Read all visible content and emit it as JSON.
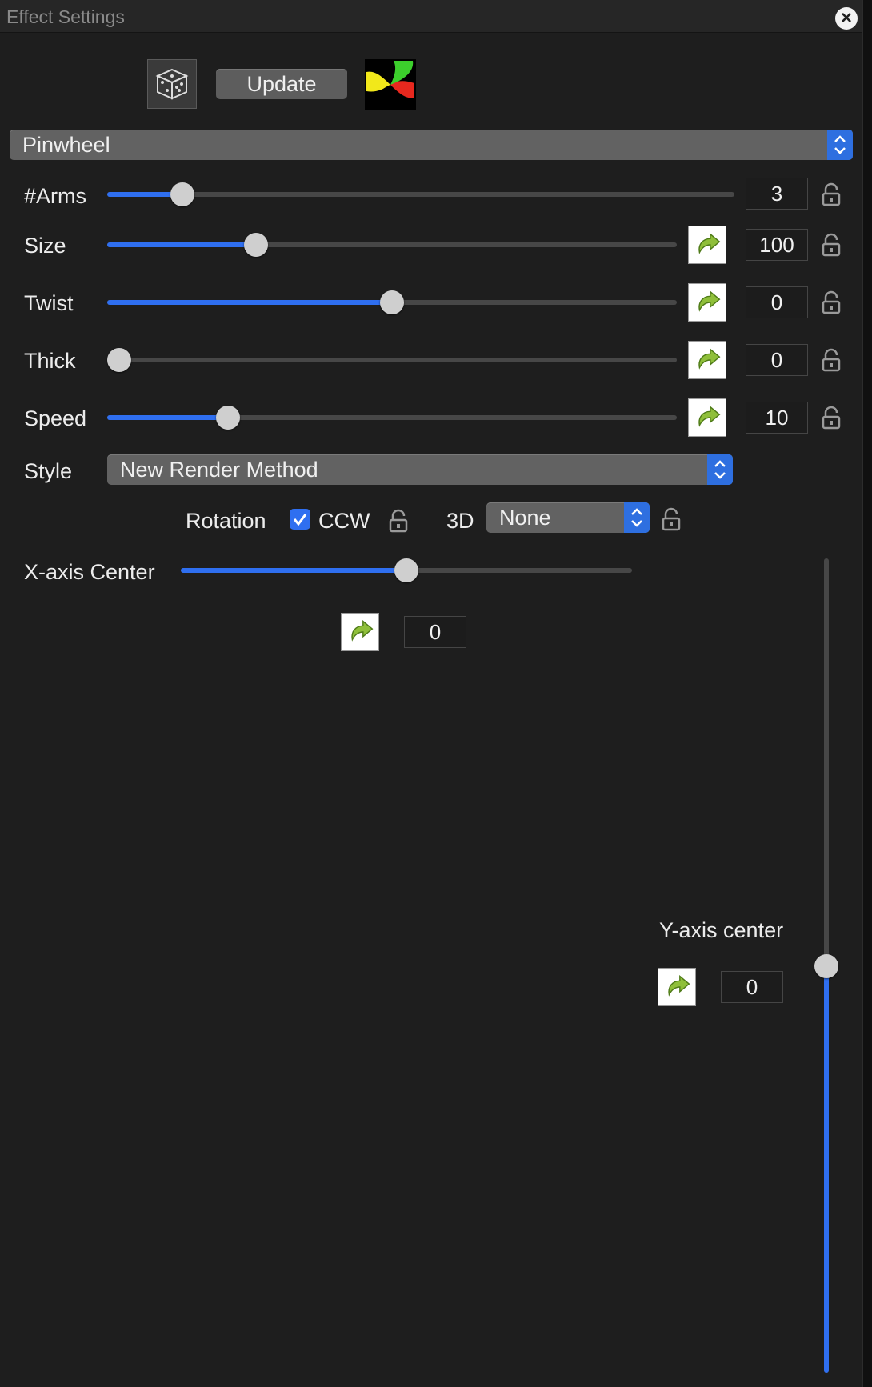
{
  "window": {
    "title": "Effect Settings"
  },
  "toolbar": {
    "update_label": "Update"
  },
  "effect_select": {
    "value": "Pinwheel"
  },
  "params": {
    "arms": {
      "label": "#Arms",
      "value": "3",
      "level": 0.12
    },
    "size": {
      "label": "Size",
      "value": "100",
      "level": 0.26
    },
    "twist": {
      "label": "Twist",
      "value": "0",
      "level": 0.5
    },
    "thick": {
      "label": "Thick",
      "value": "0",
      "level": 0.0
    },
    "speed": {
      "label": "Speed",
      "value": "10",
      "level": 0.21
    }
  },
  "style": {
    "label": "Style",
    "value": "New Render Method"
  },
  "rotation": {
    "label": "Rotation",
    "ccw_label": "CCW",
    "ccw_checked": true
  },
  "three_d": {
    "label": "3D",
    "value": "None"
  },
  "x_center": {
    "label": "X-axis Center",
    "value": "0",
    "level": 0.5
  },
  "y_center": {
    "label": "Y-axis center",
    "value": "0",
    "level": 0.5
  },
  "colors": {
    "accent": "#2f6ff0",
    "background": "#1e1e1e"
  },
  "icons": [
    "close-icon",
    "dice-icon",
    "pinwheel-preview-icon",
    "reset-arrow-icon",
    "lock-icon",
    "checkmark-icon",
    "chevron-updown-icon"
  ]
}
